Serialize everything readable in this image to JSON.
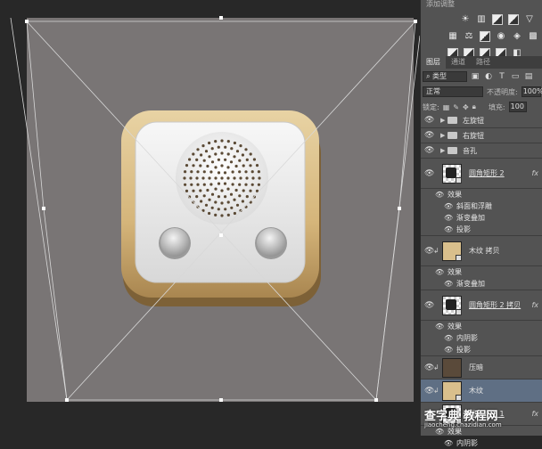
{
  "adjustments": {
    "title": "添加调整",
    "row1": [
      "sun-icon",
      "levels-icon",
      "curves-icon",
      "exposure-icon",
      "triangle-icon"
    ],
    "row2": [
      "vibrance-icon",
      "balance-icon",
      "bw-icon",
      "photo-filter-icon",
      "channel-mixer-icon",
      "grid-icon"
    ],
    "row3": [
      "invert-icon",
      "posterize-icon",
      "threshold-icon",
      "gradient-map-icon",
      "selective-color-icon"
    ]
  },
  "tabs": [
    "图层",
    "通道",
    "路径"
  ],
  "filter": {
    "kind": "类型"
  },
  "blend": {
    "mode": "正常",
    "opacity_label": "不透明度:",
    "opacity_value": "100%"
  },
  "lock": {
    "label": "锁定:",
    "fill_label": "填充:",
    "fill_value": "100"
  },
  "layers": [
    {
      "name": "左旋钮",
      "type": "folder"
    },
    {
      "name": "右旋钮",
      "type": "folder"
    },
    {
      "name": "音孔",
      "type": "folder"
    },
    {
      "name": "圆角矩形 2",
      "type": "shape",
      "fx": "fx",
      "effects_label": "效果",
      "effects": [
        "斜面和浮雕",
        "渐变叠加",
        "投影"
      ]
    },
    {
      "name": "木纹 拷贝",
      "type": "wood",
      "effects_label": "效果",
      "effects": [
        "渐变叠加"
      ]
    },
    {
      "name": "圆角矩形 2 拷贝",
      "type": "shape",
      "fx": "fx",
      "effects_label": "效果",
      "effects": [
        "内阴影",
        "投影"
      ]
    },
    {
      "name": "压暗",
      "type": "brown"
    },
    {
      "name": "木纹",
      "type": "wood",
      "selected": true
    },
    {
      "name": "圆角矩形 1",
      "type": "shape",
      "fx": "fx",
      "effects_label": "效果",
      "effects": [
        "内阴影"
      ]
    }
  ],
  "watermark": {
    "title": "查字典 教程网",
    "url": "jiaocheng.chazidian.com"
  },
  "colors": {
    "canvas": "#797575",
    "panel": "#535353",
    "selected": "#5f6f84",
    "wood": "#d9bf8c"
  }
}
